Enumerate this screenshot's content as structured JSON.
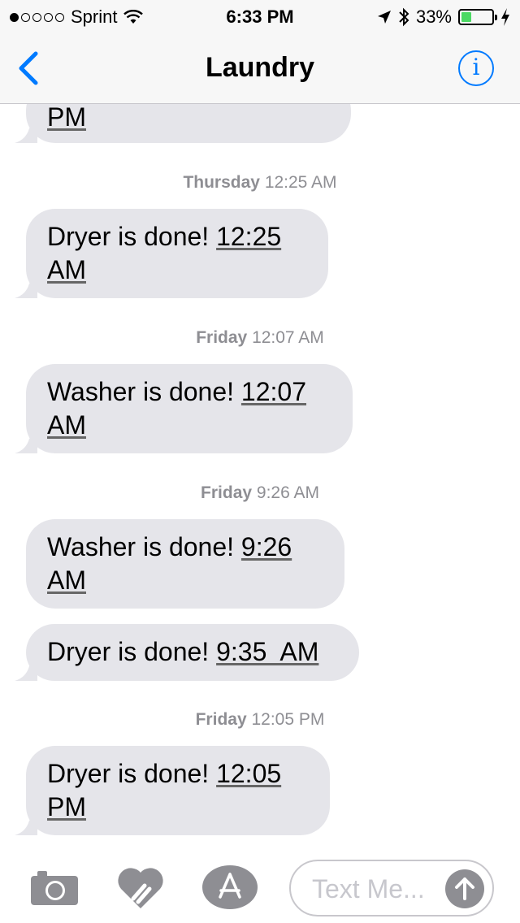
{
  "status_bar": {
    "carrier": "Sprint",
    "time": "6:33 PM",
    "battery": "33%",
    "battery_level": 0.33
  },
  "nav": {
    "title": "Laundry",
    "info_label": "i"
  },
  "conversation": {
    "partial_message": "PM",
    "groups": [
      {
        "day": "Thursday",
        "time": "12:25 AM"
      },
      {
        "day": "Friday",
        "time": "12:07 AM"
      },
      {
        "day": "Friday",
        "time": "9:26 AM"
      },
      {
        "day": "Friday",
        "time": "12:05 PM"
      }
    ],
    "messages": [
      {
        "text": "Dryer is done! ",
        "time_line1": "12:25",
        "time_line2": "AM"
      },
      {
        "text": "Washer is done! ",
        "time_line1": "12:07",
        "time_line2": "AM"
      },
      {
        "text": "Washer is done! ",
        "time_line1": "9:26",
        "time_line2": "AM"
      },
      {
        "text": "Dryer is done! ",
        "time_inline": "9:35  AM"
      },
      {
        "text": "Dryer is done! ",
        "time_line1": "12:05",
        "time_line2": "PM"
      }
    ]
  },
  "input_bar": {
    "placeholder": "Text Me..."
  },
  "colors": {
    "accent": "#007aff",
    "bubble": "#e5e5ea",
    "timestamp": "#8e8e93",
    "battery_fill": "#4cd964"
  },
  "icons": [
    "back-chevron-icon",
    "info-icon",
    "camera-icon",
    "digital-touch-icon",
    "app-store-icon",
    "send-arrow-icon",
    "wifi-icon",
    "location-arrow-icon",
    "bluetooth-icon",
    "battery-icon",
    "charging-bolt-icon"
  ]
}
